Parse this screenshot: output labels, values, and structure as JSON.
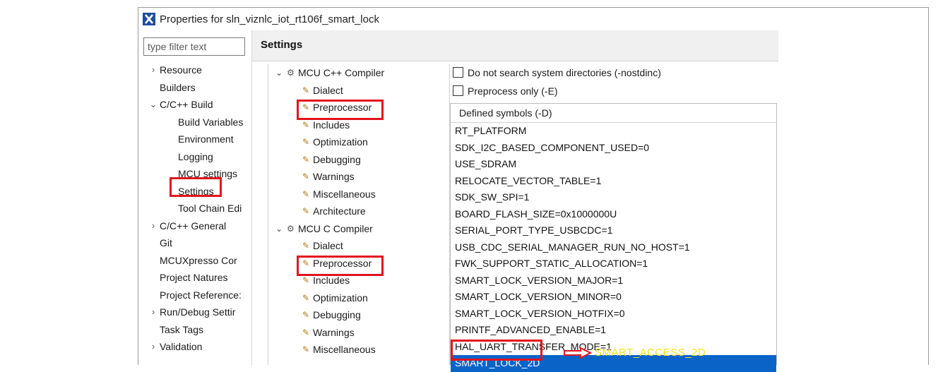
{
  "window": {
    "title": "Properties for sln_viznlc_iot_rt106f_smart_lock"
  },
  "filter": {
    "placeholder": "type filter text"
  },
  "nav_tree": [
    {
      "label": "Resource",
      "expander": "›",
      "level": 0
    },
    {
      "label": "Builders",
      "expander": "",
      "level": 0
    },
    {
      "label": "C/C++ Build",
      "expander": "⌄",
      "level": 0
    },
    {
      "label": "Build Variables",
      "expander": "",
      "level": 1
    },
    {
      "label": "Environment",
      "expander": "",
      "level": 1
    },
    {
      "label": "Logging",
      "expander": "",
      "level": 1
    },
    {
      "label": "MCU settings",
      "expander": "",
      "level": 1
    },
    {
      "label": "Settings",
      "expander": "",
      "level": 1,
      "selected": true
    },
    {
      "label": "Tool Chain Edi",
      "expander": "",
      "level": 1
    },
    {
      "label": "C/C++ General",
      "expander": "›",
      "level": 0
    },
    {
      "label": "Git",
      "expander": "",
      "level": 0
    },
    {
      "label": "MCUXpresso Cor",
      "expander": "",
      "level": 0
    },
    {
      "label": "Project Natures",
      "expander": "",
      "level": 0
    },
    {
      "label": "Project Reference:",
      "expander": "",
      "level": 0
    },
    {
      "label": "Run/Debug Settir",
      "expander": "›",
      "level": 0
    },
    {
      "label": "Task Tags",
      "expander": "",
      "level": 0
    },
    {
      "label": "Validation",
      "expander": "›",
      "level": 0
    }
  ],
  "settings": {
    "header": "Settings"
  },
  "tool_tree": [
    {
      "label": "MCU C++ Compiler",
      "type": "group"
    },
    {
      "label": "Dialect",
      "type": "child"
    },
    {
      "label": "Preprocessor",
      "type": "child",
      "highlighted": true
    },
    {
      "label": "Includes",
      "type": "child"
    },
    {
      "label": "Optimization",
      "type": "child"
    },
    {
      "label": "Debugging",
      "type": "child"
    },
    {
      "label": "Warnings",
      "type": "child"
    },
    {
      "label": "Miscellaneous",
      "type": "child"
    },
    {
      "label": "Architecture",
      "type": "child"
    },
    {
      "label": "MCU C Compiler",
      "type": "group"
    },
    {
      "label": "Dialect",
      "type": "child"
    },
    {
      "label": "Preprocessor",
      "type": "child",
      "highlighted": true
    },
    {
      "label": "Includes",
      "type": "child"
    },
    {
      "label": "Optimization",
      "type": "child"
    },
    {
      "label": "Debugging",
      "type": "child"
    },
    {
      "label": "Warnings",
      "type": "child"
    },
    {
      "label": "Miscellaneous",
      "type": "child"
    }
  ],
  "options": {
    "nostdinc_label": "Do not search system directories (-nostdinc)",
    "nostdinc_checked": false,
    "preprocess_only_label": "Preprocess only (-E)",
    "preprocess_only_checked": false
  },
  "symbols": {
    "header": "Defined symbols (-D)",
    "items": [
      "RT_PLATFORM",
      "SDK_I2C_BASED_COMPONENT_USED=0",
      "USE_SDRAM",
      "RELOCATE_VECTOR_TABLE=1",
      "SDK_SW_SPI=1",
      "BOARD_FLASH_SIZE=0x1000000U",
      "SERIAL_PORT_TYPE_USBCDC=1",
      "USB_CDC_SERIAL_MANAGER_RUN_NO_HOST=1",
      "FWK_SUPPORT_STATIC_ALLOCATION=1",
      "SMART_LOCK_VERSION_MAJOR=1",
      "SMART_LOCK_VERSION_MINOR=0",
      "SMART_LOCK_VERSION_HOTFIX=0",
      "PRINTF_ADVANCED_ENABLE=1",
      "HAL_UART_TRANSFER_MODE=1",
      "SMART_LOCK_2D"
    ],
    "selected_index": 14
  },
  "annotation": {
    "text": "SMART_ACCESS_2D"
  },
  "colors": {
    "highlight": "#e3141c",
    "selection": "#0a64c8",
    "annotation_text": "#f5e21b"
  }
}
